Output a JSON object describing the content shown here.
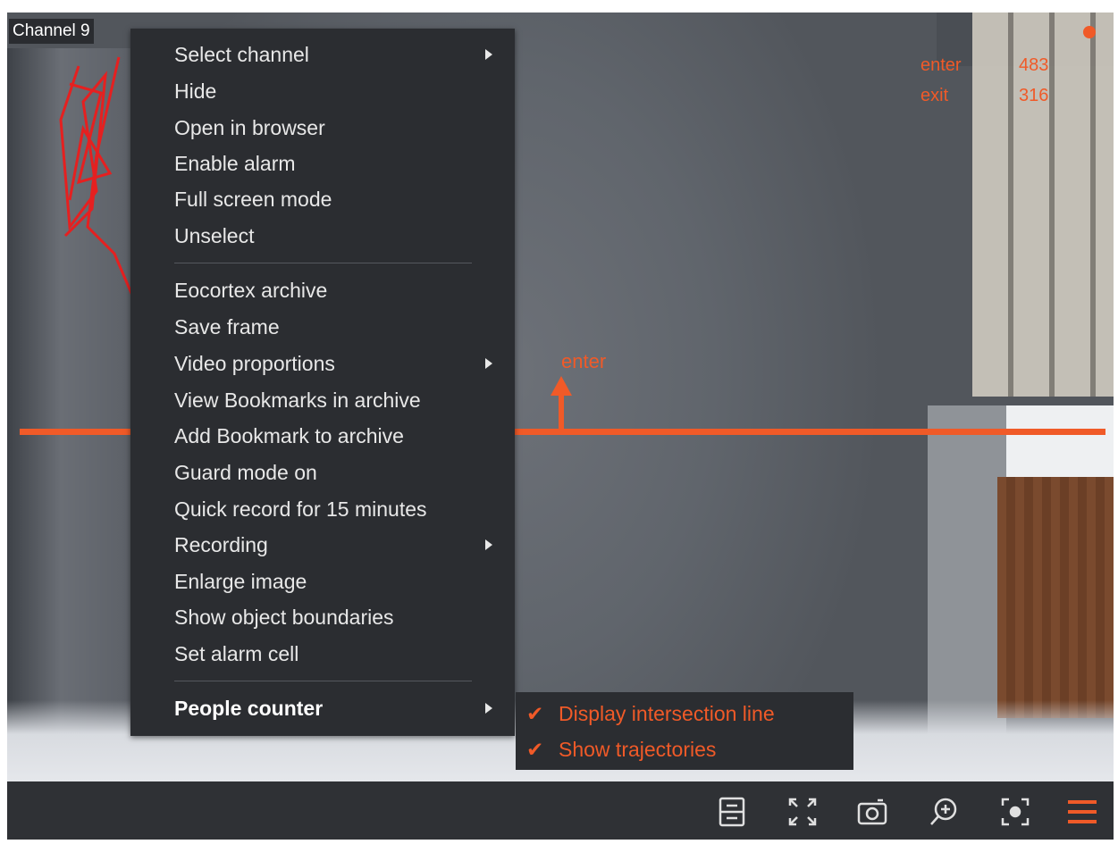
{
  "channel": {
    "title": "Channel 9"
  },
  "counter": {
    "enter_label": "enter",
    "enter_value": "483",
    "exit_label": "exit",
    "exit_value": "316"
  },
  "line": {
    "direction_label": "enter"
  },
  "context_menu": {
    "items": [
      {
        "label": "Select channel",
        "submenu": true
      },
      {
        "label": "Hide"
      },
      {
        "label": "Open in browser"
      },
      {
        "label": "Enable alarm"
      },
      {
        "label": "Full screen mode"
      },
      {
        "label": "Unselect"
      },
      {
        "label": "Eocortex archive"
      },
      {
        "label": "Save frame"
      },
      {
        "label": "Video proportions",
        "submenu": true
      },
      {
        "label": "View Bookmarks in archive"
      },
      {
        "label": "Add Bookmark to archive"
      },
      {
        "label": "Guard mode on"
      },
      {
        "label": "Quick record for 15 minutes"
      },
      {
        "label": "Recording",
        "submenu": true
      },
      {
        "label": "Enlarge image"
      },
      {
        "label": "Show object boundaries"
      },
      {
        "label": "Set alarm cell"
      },
      {
        "label": "People counter",
        "submenu": true
      }
    ]
  },
  "people_counter_submenu": {
    "items": [
      {
        "label": "Display intersection line",
        "checked": true
      },
      {
        "label": "Show trajectories",
        "checked": true
      }
    ],
    "check_glyph": "✔"
  },
  "toolbar": {
    "icons": [
      "layout-icon",
      "fullscreen-icon",
      "snapshot-icon",
      "zoom-in-icon",
      "focus-icon",
      "menu-icon"
    ]
  },
  "colors": {
    "accent": "#f05a28",
    "menu_bg": "#2b2d31",
    "toolbar_bg": "#2f3135"
  }
}
